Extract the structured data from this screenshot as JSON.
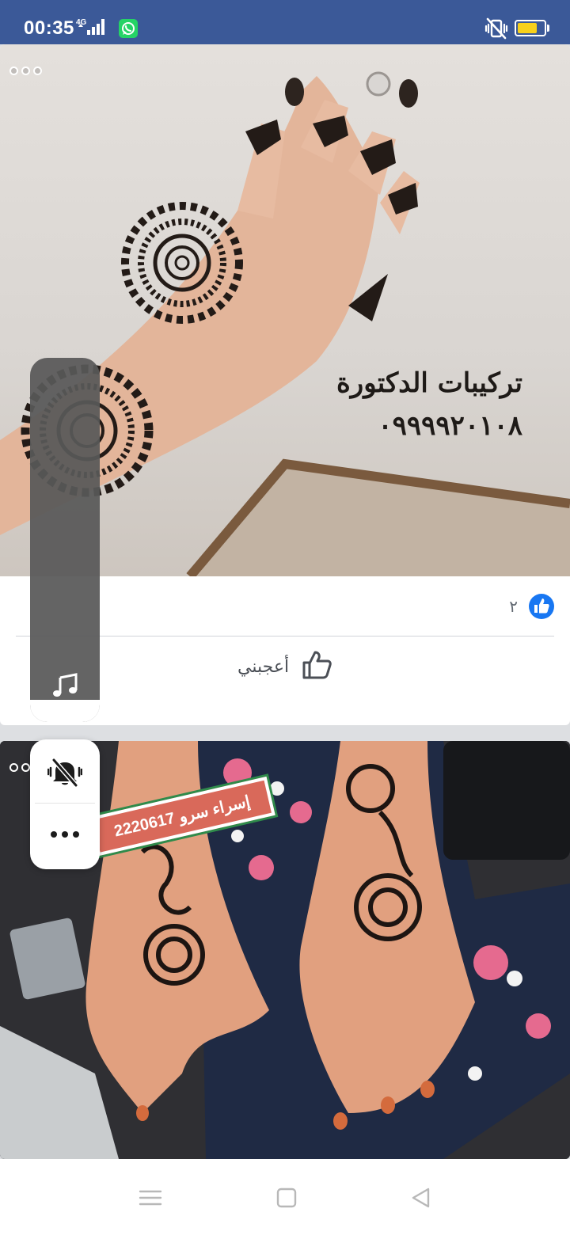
{
  "status_bar": {
    "time": "00:35",
    "network_label": "4G",
    "battery_level": 0.75,
    "battery_color": "#f8d11b",
    "bar_color": "#3b5998",
    "icons": [
      "signal-icon",
      "whatsapp-icon",
      "vibrate-icon",
      "battery-icon"
    ]
  },
  "post_1": {
    "image_text_title": "تركيبات الدكتورة",
    "image_text_phone": "٠٩٩٩٩٢٠١٠٨",
    "reaction_count": "٢",
    "like_label": "أعجبني",
    "like_color": "#1877f2"
  },
  "post_2": {
    "ribbon_name": "إسراء سرو",
    "ribbon_number": "2220617"
  },
  "floating_player": {
    "icon": "music-note-icon"
  },
  "floating_menu": {
    "items": [
      "mute-icon",
      "more-icon"
    ]
  },
  "navigation": {
    "buttons": [
      "menu-icon",
      "home-icon",
      "back-icon"
    ]
  }
}
